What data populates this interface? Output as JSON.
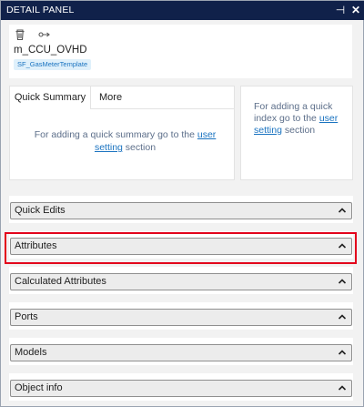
{
  "window": {
    "title": "DETAIL PANEL",
    "pin_glyph": "⊣",
    "close_glyph": "✕"
  },
  "header": {
    "icons": [
      "trash-icon",
      "link-icon"
    ],
    "object_name": "m_CCU_OVHD",
    "template_tag": "SF_GasMeterTemplate"
  },
  "quick_summary": {
    "tabs": [
      "Quick Summary",
      "More"
    ],
    "text_before": "For adding a quick summary go to the ",
    "link_text": "user setting",
    "text_after": " section"
  },
  "quick_index": {
    "text_before": "For adding a quick index go to the ",
    "link_text": "user setting",
    "text_after": " section"
  },
  "sections": [
    {
      "label": "Quick Edits"
    },
    {
      "label": "Attributes",
      "highlighted": true
    },
    {
      "label": "Calculated Attributes"
    },
    {
      "label": "Ports"
    },
    {
      "label": "Models"
    },
    {
      "label": "Object info"
    }
  ],
  "colors": {
    "titlebar": "#10214a",
    "highlight": "#e3001b",
    "link": "#1a73c0",
    "tag_bg": "#dff0fb"
  }
}
